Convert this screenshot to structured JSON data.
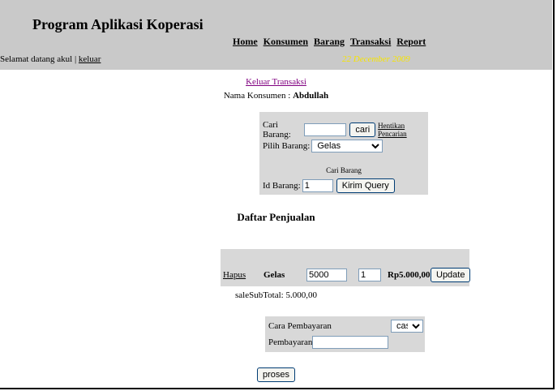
{
  "header": {
    "title": "Program Aplikasi Koperasi",
    "nav": [
      "Home",
      "Konsumen",
      "Barang",
      "Transaksi",
      "Report"
    ],
    "welcome_text": "Selamat datang akul | ",
    "logout_label": "keluar",
    "date": "22 December 2009",
    "date_color": "#f7e400"
  },
  "transaction": {
    "exit_label": "Keluar Transaksi",
    "customer_label": "Nama Konsumen : ",
    "customer_name": "Abdullah"
  },
  "search": {
    "cari_label": "Cari Barang:",
    "cari_value": "",
    "cari_button": "cari",
    "stop_link": "Hentikan Pencarian",
    "pilih_label": "Pilih Barang:",
    "pilih_selected": "Gelas",
    "caption": "Cari Barang",
    "id_label": "Id Barang:",
    "id_value": "1",
    "submit_button": "Kirim Query"
  },
  "sales": {
    "title": "Daftar Penjualan",
    "row": {
      "hapus": "Hapus",
      "item": "Gelas",
      "price": "5000",
      "qty": "1",
      "total": "Rp5.000,00",
      "update_button": "Update"
    },
    "subtotal": "saleSubTotal: 5.000,00"
  },
  "payment": {
    "method_label": "Cara Pembayaran",
    "method_selected": "cash",
    "amount_label": "Pembayaran :",
    "amount_value": "",
    "submit_button": "proses"
  }
}
